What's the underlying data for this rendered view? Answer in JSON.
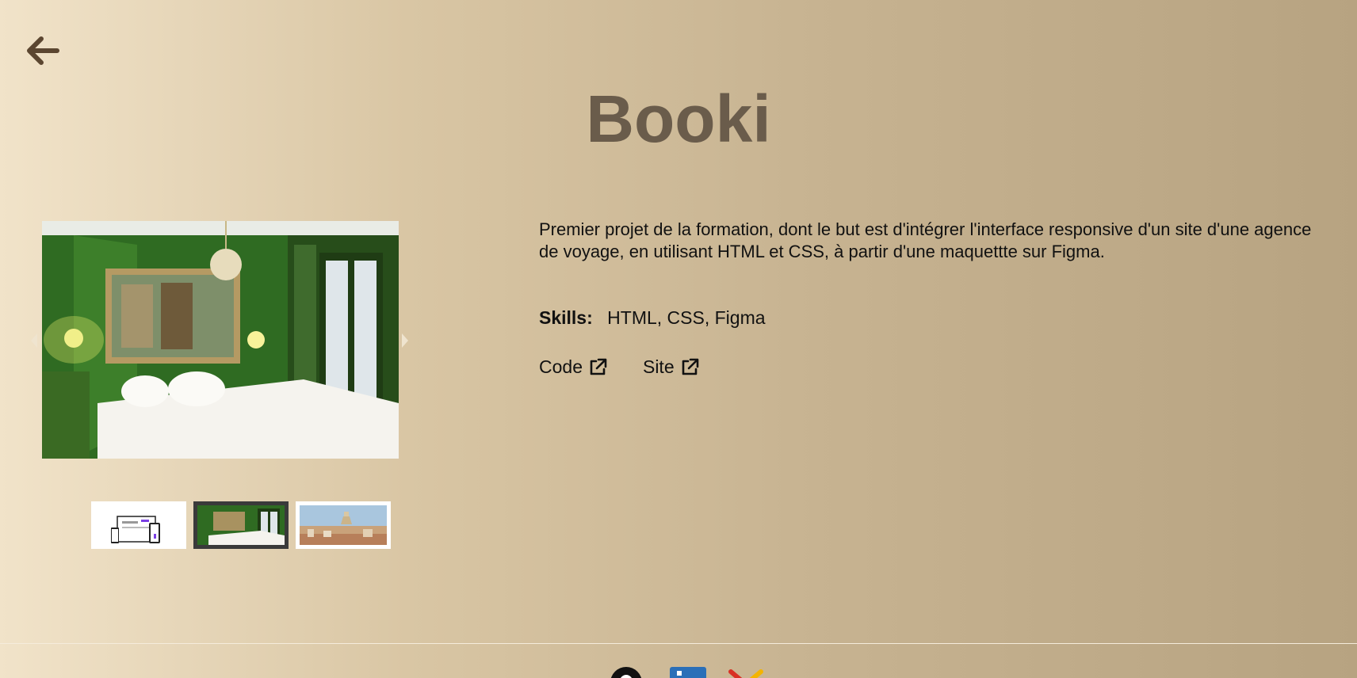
{
  "header": {
    "back_icon": "arrow-left-icon",
    "title": "Booki"
  },
  "carousel": {
    "prev_icon": "chevron-left-icon",
    "next_icon": "chevron-right-icon",
    "active_index": 1,
    "thumbnails": [
      {
        "name": "booki-website-mockup"
      },
      {
        "name": "green-hotel-room"
      },
      {
        "name": "marseille-cityscape"
      }
    ]
  },
  "project": {
    "description": "Premier projet de la formation, dont le but est d'intégrer l'interface responsive d'un site d'une agence de voyage, en utilisant HTML et CSS, à partir d'une maquettte sur Figma.",
    "skills_label": "Skills:",
    "skills_value": "HTML, CSS, Figma",
    "links": [
      {
        "label": "Code",
        "icon": "external-link-icon"
      },
      {
        "label": "Site",
        "icon": "external-link-icon"
      }
    ]
  },
  "footer": {
    "icons": [
      "github-icon",
      "linkedin-icon",
      "gmail-icon"
    ]
  },
  "colors": {
    "title": "#6a5c4b",
    "back_arrow": "#5b4630",
    "active_thumb_border": "#3a3a3a"
  }
}
